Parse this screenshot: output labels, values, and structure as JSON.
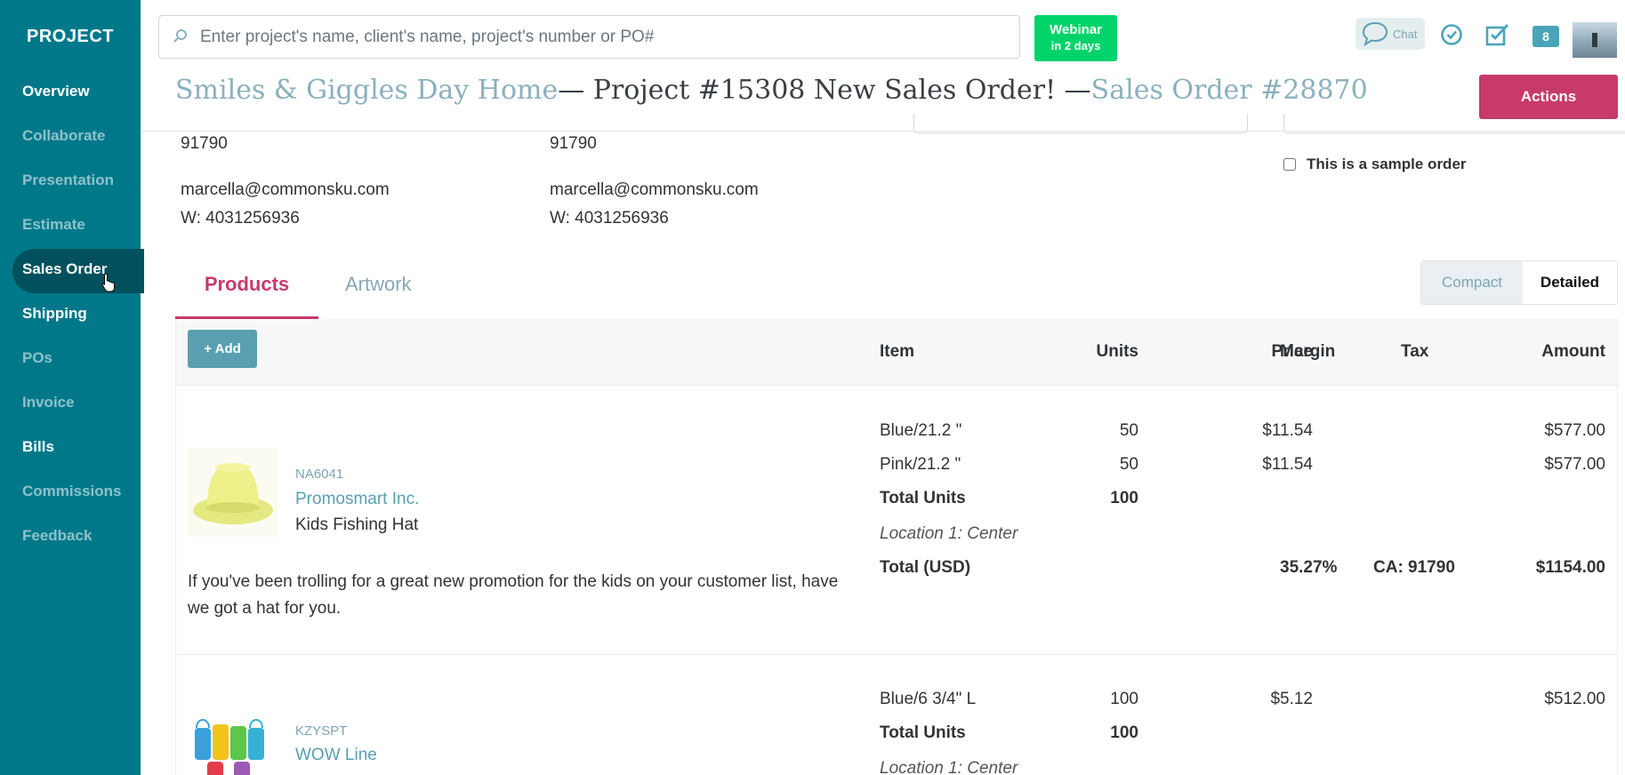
{
  "sidebar": {
    "title": "PROJECT",
    "items": [
      {
        "label": "Overview",
        "state": "bright"
      },
      {
        "label": "Collaborate",
        "state": "dim"
      },
      {
        "label": "Presentation",
        "state": "dim"
      },
      {
        "label": "Estimate",
        "state": "dim"
      },
      {
        "label": "Sales Order",
        "state": "active"
      },
      {
        "label": "Shipping",
        "state": "bright"
      },
      {
        "label": "POs",
        "state": "dim"
      },
      {
        "label": "Invoice",
        "state": "dim"
      },
      {
        "label": "Bills",
        "state": "bright"
      },
      {
        "label": "Commissions",
        "state": "dim"
      },
      {
        "label": "Feedback",
        "state": "dim"
      }
    ]
  },
  "topbar": {
    "search_placeholder": "Enter project's name, client's name, project's number or PO#",
    "webinar_line1": "Webinar",
    "webinar_line2": "in 2 days",
    "chat_label": "Chat",
    "notification_count": "8"
  },
  "header": {
    "client": "Smiles & Giggles Day Home",
    "project": "— Project #15308 New Sales Order! —",
    "sales_order": "Sales Order #28870",
    "actions_label": "Actions"
  },
  "addresses": {
    "left": {
      "postal": "91790",
      "email": "marcella@commonsku.com",
      "phone": "W: 4031256936"
    },
    "right": {
      "postal": "91790",
      "email": "marcella@commonsku.com",
      "phone": "W: 4031256936"
    },
    "sample_label": "This is a sample order"
  },
  "tabs": {
    "products": "Products",
    "artwork": "Artwork",
    "compact": "Compact",
    "detailed": "Detailed"
  },
  "table": {
    "add_label": "+ Add",
    "columns": {
      "item": "Item",
      "units": "Units",
      "price": "Price",
      "margin": "Margin",
      "tax": "Tax",
      "amount": "Amount"
    },
    "rows": [
      {
        "sku": "NA6041",
        "supplier": "Promosmart Inc.",
        "name": "Kids Fishing Hat",
        "description": "If you've been trolling for a great new promotion for the kids on your customer list, have we got a hat for you.",
        "lines": [
          {
            "item": "Blue/21.2 \"",
            "units": "50",
            "price": "$11.54",
            "amount": "$577.00"
          },
          {
            "item": "Pink/21.2 \"",
            "units": "50",
            "price": "$11.54",
            "amount": "$577.00"
          }
        ],
        "total_units_label": "Total Units",
        "total_units": "100",
        "location": "Location 1: Center",
        "total_label": "Total (USD)",
        "margin": "35.27%",
        "tax": "CA: 91790",
        "total_amount": "$1154.00"
      },
      {
        "sku": "KZYSPT",
        "supplier": "WOW Line",
        "lines": [
          {
            "item": "Blue/6 3/4\" L",
            "units": "100",
            "price": "$5.12",
            "amount": "$512.00"
          }
        ],
        "total_units_label": "Total Units",
        "total_units": "100",
        "location": "Location 1: Center"
      }
    ]
  }
}
